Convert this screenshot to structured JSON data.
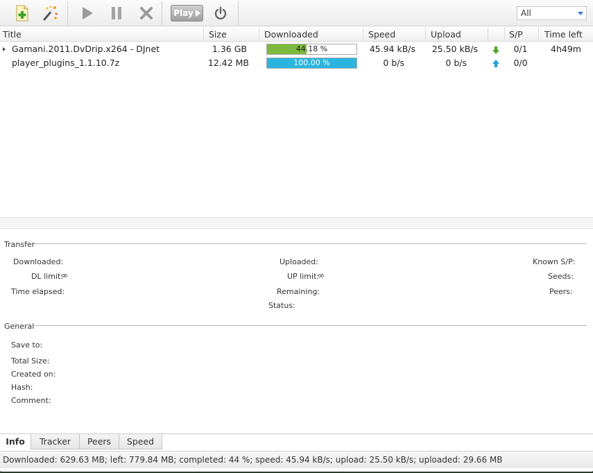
{
  "toolbar": {
    "icons": [
      "add-torrent-icon",
      "magic-wand-icon",
      "play-icon",
      "pause-icon",
      "stop-icon",
      "power-icon"
    ],
    "play_label": "Play",
    "filter_value": "All"
  },
  "table": {
    "headers": [
      "Title",
      "Size",
      "Downloaded",
      "Speed",
      "Upload",
      "S/P",
      "Time left"
    ],
    "rows": [
      {
        "title": "Gamani.2011.DvDrip.x264 - DJnet",
        "size": "1.36 GB",
        "progress": 44.18,
        "progress_text": "44.18 %",
        "speed": "45.94 kB/s",
        "upload": "25.50 kB/s",
        "sp": "0/1",
        "time_left": "4h49m",
        "direction": "down-arrow-icon"
      },
      {
        "title": "player_plugins_1.1.10.7z",
        "size": "12.42 MB",
        "progress": 100,
        "progress_text": "100.00 %",
        "speed": "0 b/s",
        "upload": "0 b/s",
        "sp": "0/0",
        "time_left": "",
        "direction": "up-arrow-icon"
      }
    ]
  },
  "colors": {
    "progress_downloading": "#7cb93c",
    "progress_complete": "#29b5e0",
    "arrow_down": "#4aa51f",
    "arrow_up": "#1e9ee6"
  },
  "transfer": {
    "title": "Transfer",
    "downloaded_label": "Downloaded:",
    "dl_limit_label": "DL limit:",
    "dl_limit_value": "∞",
    "time_elapsed_label": "Time elapsed:",
    "uploaded_label": "Uploaded:",
    "up_limit_label": "UP limit:",
    "up_limit_value": "∞",
    "remaining_label": "Remaining:",
    "status_label": "Status:",
    "known_sp_label": "Known S/P:",
    "seeds_label": "Seeds:",
    "peers_label": "Peers:"
  },
  "general": {
    "title": "General",
    "save_to_label": "Save to:",
    "total_size_label": "Total Size:",
    "created_on_label": "Created on:",
    "hash_label": "Hash:",
    "comment_label": "Comment:"
  },
  "tabs": [
    "Info",
    "Tracker",
    "Peers",
    "Speed"
  ],
  "status_bar": "Downloaded: 629.63 MB; left: 779.84 MB; completed: 44 %; speed: 45.94 kB/s; upload: 25.50 kB/s; uploaded: 29.66 MB"
}
